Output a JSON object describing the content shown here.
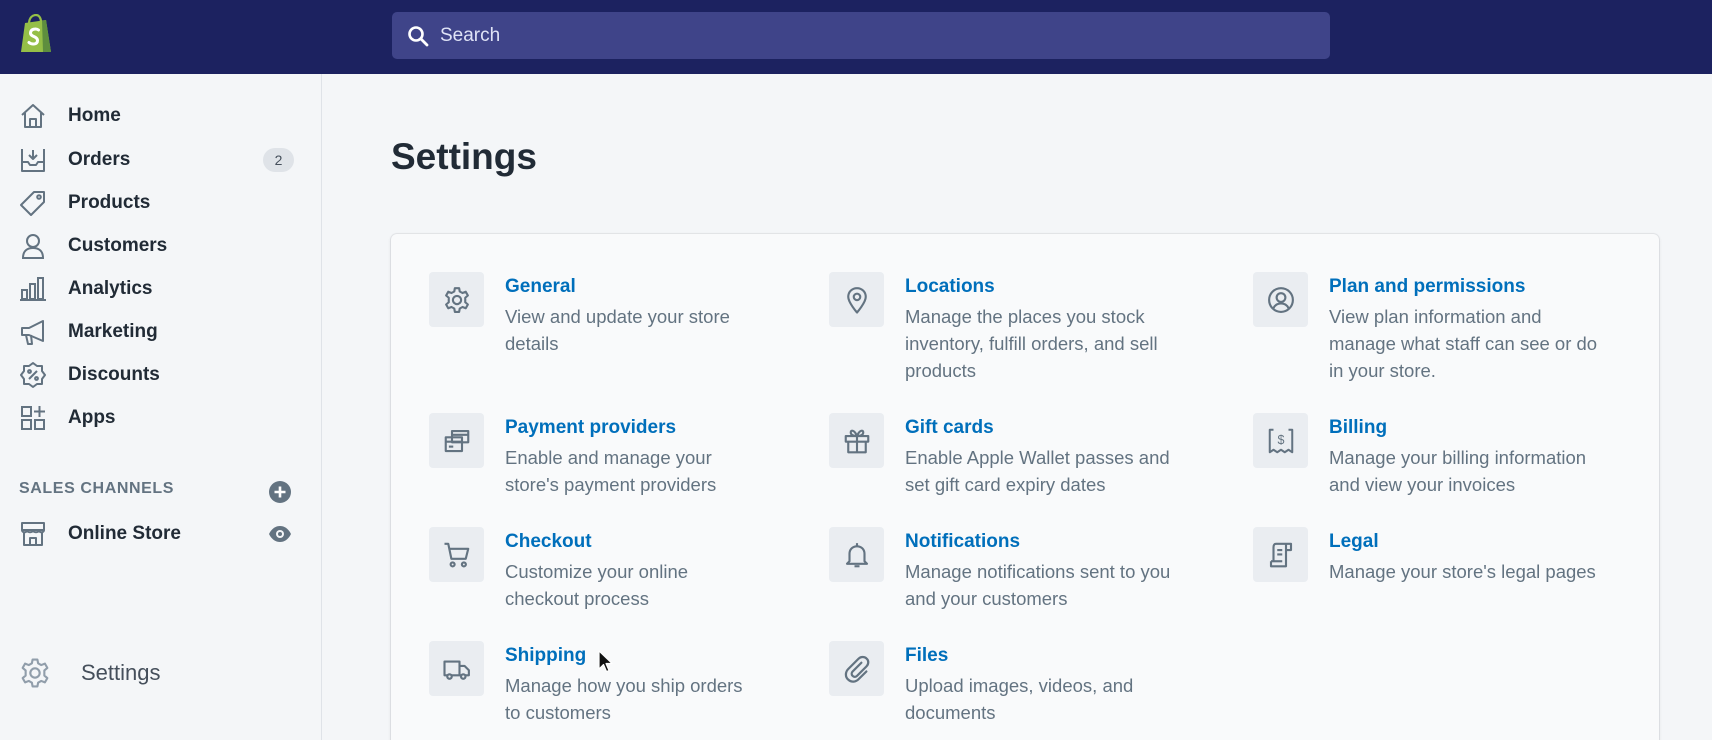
{
  "app": {
    "brand": "shopify",
    "brand_color": "#95bf47",
    "topbar_color": "#1c2260",
    "link_color": "#006fbb"
  },
  "search": {
    "placeholder": "Search",
    "value": "",
    "icon": "search-icon"
  },
  "sidebar": {
    "items": [
      {
        "id": "home",
        "label": "Home",
        "icon": "home-icon"
      },
      {
        "id": "orders",
        "label": "Orders",
        "icon": "orders-icon",
        "badge": "2"
      },
      {
        "id": "products",
        "label": "Products",
        "icon": "tag-icon"
      },
      {
        "id": "customers",
        "label": "Customers",
        "icon": "person-icon"
      },
      {
        "id": "analytics",
        "label": "Analytics",
        "icon": "bar-chart-icon"
      },
      {
        "id": "marketing",
        "label": "Marketing",
        "icon": "megaphone-icon"
      },
      {
        "id": "discounts",
        "label": "Discounts",
        "icon": "discount-icon"
      },
      {
        "id": "apps",
        "label": "Apps",
        "icon": "apps-icon"
      }
    ],
    "sales_channels": {
      "title": "SALES CHANNELS",
      "add_icon": "plus-circle-icon",
      "items": [
        {
          "id": "online-store",
          "label": "Online Store",
          "icon": "store-icon",
          "action_icon": "eye-icon"
        }
      ]
    },
    "settings": {
      "label": "Settings",
      "icon": "gear-icon"
    }
  },
  "page": {
    "title": "Settings",
    "settings_items": [
      {
        "id": "general",
        "title": "General",
        "desc": [
          "View and update your store",
          "details"
        ],
        "icon": "gear-icon"
      },
      {
        "id": "locations",
        "title": "Locations",
        "desc": [
          "Manage the places you stock",
          "inventory, fulfill orders, and sell",
          "products"
        ],
        "icon": "location-pin-icon"
      },
      {
        "id": "plan",
        "title": "Plan and permissions",
        "desc": [
          "View plan information and",
          "manage what staff can see or do",
          "in your store."
        ],
        "icon": "user-circle-icon"
      },
      {
        "id": "payment",
        "title": "Payment providers",
        "desc": [
          "Enable and manage your",
          "store's payment providers"
        ],
        "icon": "payment-cards-icon"
      },
      {
        "id": "giftcards",
        "title": "Gift cards",
        "desc": [
          "Enable Apple Wallet passes and",
          "set gift card expiry dates"
        ],
        "icon": "gift-icon"
      },
      {
        "id": "billing",
        "title": "Billing",
        "desc": [
          "Manage your billing information",
          "and view your invoices"
        ],
        "icon": "billing-receipt-icon"
      },
      {
        "id": "checkout",
        "title": "Checkout",
        "desc": [
          "Customize your online",
          "checkout process"
        ],
        "icon": "cart-icon"
      },
      {
        "id": "notifications",
        "title": "Notifications",
        "desc": [
          "Manage notifications sent to you",
          "and your customers"
        ],
        "icon": "bell-icon"
      },
      {
        "id": "legal",
        "title": "Legal",
        "desc": [
          "Manage your store's legal pages"
        ],
        "icon": "document-icon"
      },
      {
        "id": "shipping",
        "title": "Shipping",
        "desc": [
          "Manage how you ship orders",
          "to customers"
        ],
        "icon": "truck-icon"
      },
      {
        "id": "files",
        "title": "Files",
        "desc": [
          "Upload images, videos, and",
          "documents"
        ],
        "icon": "paperclip-icon"
      }
    ]
  }
}
